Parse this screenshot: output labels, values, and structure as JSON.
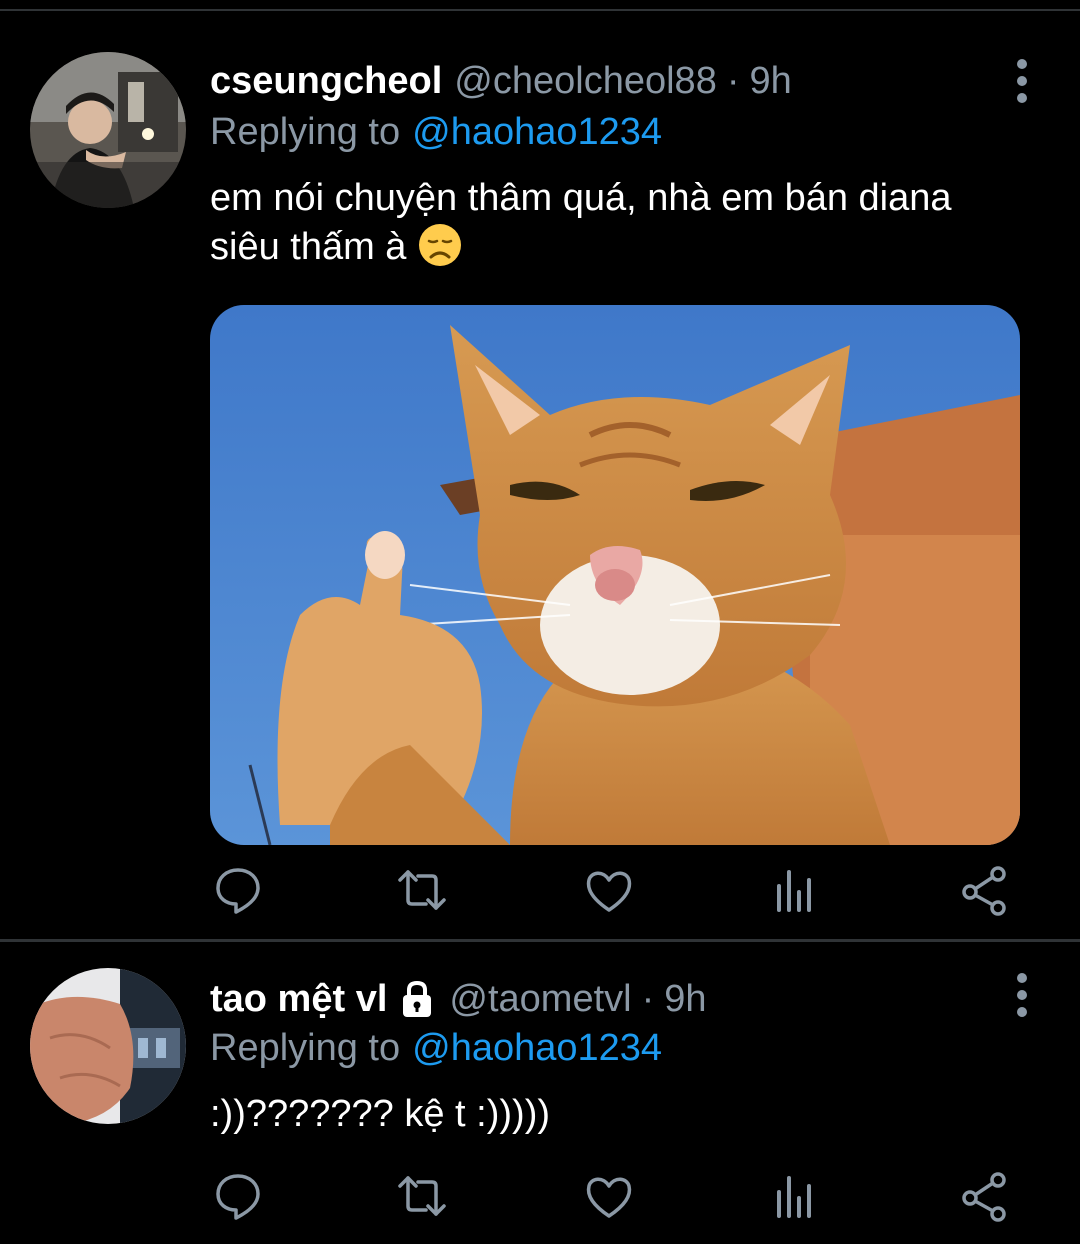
{
  "tweets": [
    {
      "name": "cseungcheol",
      "handle": "@cheolcheol88",
      "separator": "·",
      "time": "9h",
      "replying_label": "Replying to",
      "replying_to": "@haohao1234",
      "text_line1": "em nói chuyện thâm quá, nhà em bán diana",
      "text_line2": "siêu thấm à",
      "emoji": "disappointed-face-emoji",
      "has_media": true,
      "media_description_icon": "cat-thumbs-up-image",
      "locked": false
    },
    {
      "name": "tao mệt vl",
      "handle": "@taometvl",
      "separator": "·",
      "time": "9h",
      "replying_label": "Replying to",
      "replying_to": "@haohao1234",
      "text_line1": ":))??????? kệ t :)))))",
      "locked": true
    }
  ],
  "action_icons": [
    "reply-icon",
    "retweet-icon",
    "like-icon",
    "analytics-icon",
    "share-icon"
  ],
  "colors": {
    "background": "#000000",
    "secondary_text": "#8b98a5",
    "link": "#1d9bf0",
    "divider": "#2f3336"
  }
}
